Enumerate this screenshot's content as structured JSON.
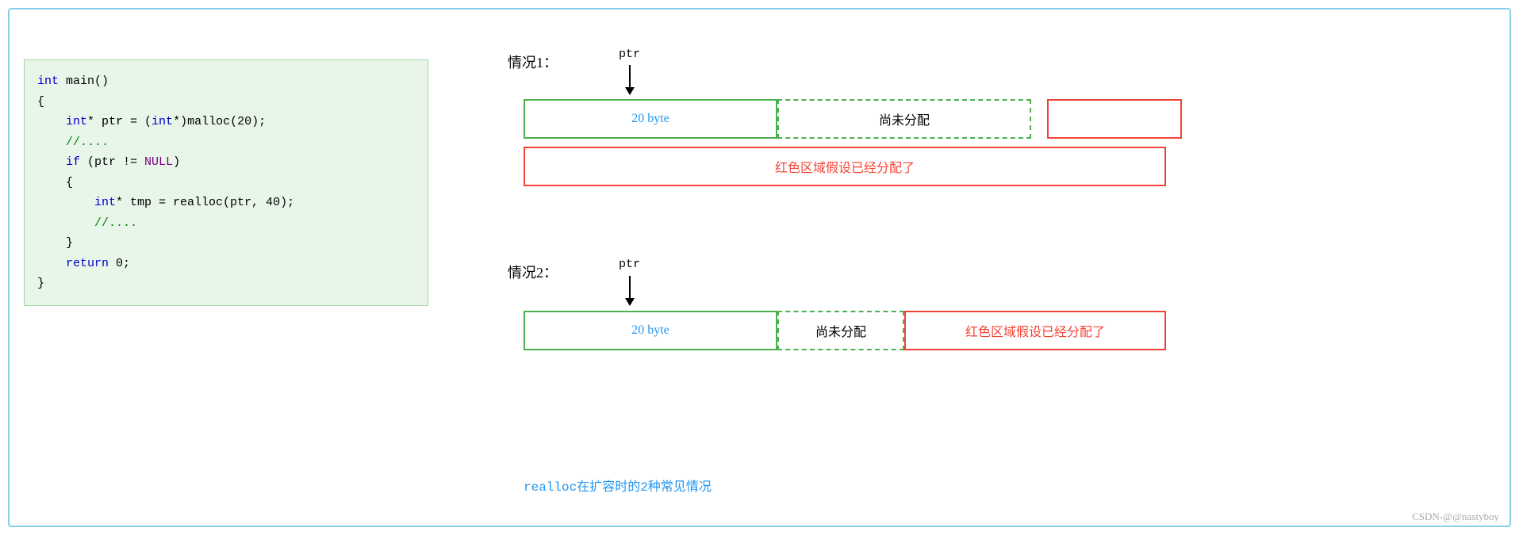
{
  "border": {
    "color": "#87ceeb"
  },
  "code": {
    "lines": [
      {
        "text": "int main()",
        "parts": [
          {
            "t": "int",
            "cls": "kw"
          },
          {
            "t": " main()",
            "cls": ""
          }
        ]
      },
      {
        "text": "{",
        "parts": [
          {
            "t": "{",
            "cls": ""
          }
        ]
      },
      {
        "text": "    int* ptr = (int*)malloc(20);",
        "parts": [
          {
            "t": "    ",
            "cls": ""
          },
          {
            "t": "int",
            "cls": "kw"
          },
          {
            "t": "* ptr = (",
            "cls": ""
          },
          {
            "t": "int",
            "cls": "kw"
          },
          {
            "t": "*)malloc(20);",
            "cls": ""
          }
        ]
      },
      {
        "text": "    //....",
        "parts": [
          {
            "t": "    //....",
            "cls": "cm"
          }
        ]
      },
      {
        "text": "    if (ptr != NULL)",
        "parts": [
          {
            "t": "    ",
            "cls": ""
          },
          {
            "t": "if",
            "cls": "kw"
          },
          {
            "t": " (ptr != ",
            "cls": ""
          },
          {
            "t": "NULL",
            "cls": "kw2"
          },
          {
            "t": ")",
            "cls": ""
          }
        ]
      },
      {
        "text": "    {",
        "parts": [
          {
            "t": "    {",
            "cls": ""
          }
        ]
      },
      {
        "text": "        int* tmp = realloc(ptr, 40);",
        "parts": [
          {
            "t": "        ",
            "cls": ""
          },
          {
            "t": "int",
            "cls": "kw"
          },
          {
            "t": "* tmp = realloc(ptr, 40);",
            "cls": ""
          }
        ]
      },
      {
        "text": "        //....",
        "parts": [
          {
            "t": "        //....",
            "cls": "cm"
          }
        ]
      },
      {
        "text": "    }",
        "parts": [
          {
            "t": "    }",
            "cls": ""
          }
        ]
      },
      {
        "text": "    return 0;",
        "parts": [
          {
            "t": "    ",
            "cls": ""
          },
          {
            "t": "return",
            "cls": "kw"
          },
          {
            "t": " 0;",
            "cls": ""
          }
        ]
      },
      {
        "text": "}",
        "parts": [
          {
            "t": "}",
            "cls": ""
          }
        ]
      }
    ]
  },
  "case1": {
    "label": "情况1：",
    "ptr_label": "ptr",
    "box1_text": "20 byte",
    "box2_text": "尚未分配",
    "box3_text": "",
    "red_bar_text": "红色区域假设已经分配了"
  },
  "case2": {
    "label": "情况2：",
    "ptr_label": "ptr",
    "box1_text": "20 byte",
    "box2_text": "尚未分配",
    "box3_text": "红色区域假设已经分配了"
  },
  "caption": "realloc在扩容时的2种常见情况",
  "watermark": "CSDN-@@nastyboy"
}
